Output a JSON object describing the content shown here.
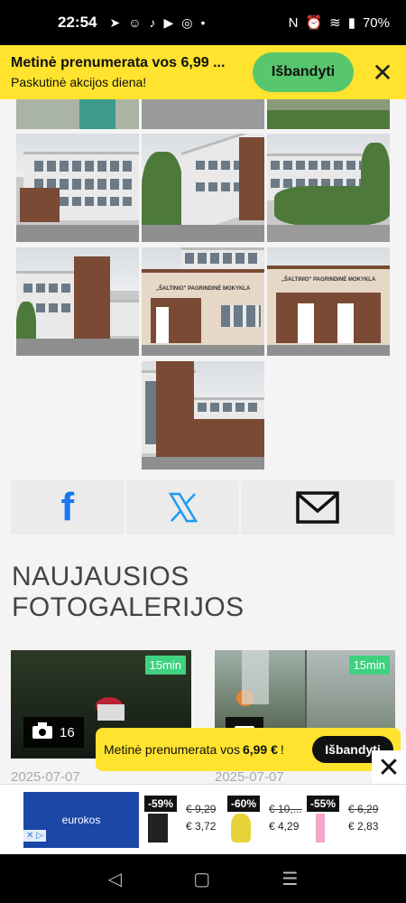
{
  "status": {
    "time": "22:54",
    "battery": "70%"
  },
  "promo": {
    "title": "Metinė prenumerata vos 6,99 ...",
    "subtitle": "Paskutinė akcijos diena!",
    "cta": "Išbandyti"
  },
  "share": {
    "facebook": "f"
  },
  "heading": {
    "line1": "NAUJAUSIOS",
    "line2": "FOTOGALERIJOS"
  },
  "galleries": [
    {
      "badge": "15min",
      "count": "16",
      "date": "2025-07-07"
    },
    {
      "badge": "15min",
      "date": "2025-07-07"
    }
  ],
  "floating": {
    "text_pre": "Metinė prenumerata vos",
    "price": "6,99 €",
    "text_post": "!",
    "cta": "Išbandyti"
  },
  "ad": {
    "brand": "eurokos",
    "products": [
      {
        "discount": "-59%",
        "old": "€ 9,29",
        "new": "€ 3,72"
      },
      {
        "discount": "-60%",
        "old": "€ 10,...",
        "new": "€ 4,29"
      },
      {
        "discount": "-55%",
        "old": "€ 6,29",
        "new": "€ 2,83"
      }
    ]
  },
  "school_sign": "„ŠALTINIO\" PAGRINDINĖ MOKYKLA",
  "colors": {
    "promo_yellow": "#ffe32e",
    "cta_green": "#58c66c",
    "badge_green": "#3fd17f",
    "facebook_blue": "#1877f2",
    "twitter_blue": "#1d9bf0"
  }
}
